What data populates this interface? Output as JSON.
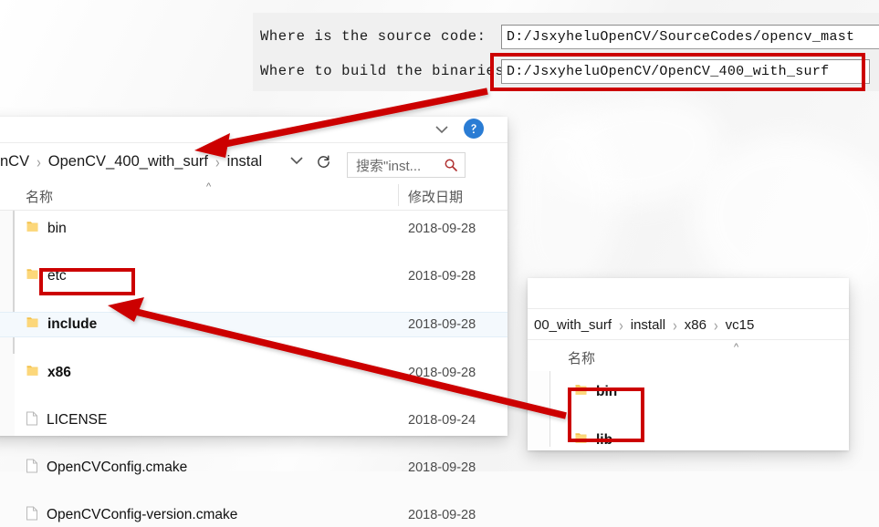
{
  "background": {
    "color": "#fbfbfb"
  },
  "accents": {
    "highlight_red": "#cc0000",
    "folder_yellow": "#f6c555",
    "help_blue": "#2a7cd4",
    "selection_blue": "#f4f9fd"
  },
  "cmake_dialog": {
    "source_row": {
      "label": "Where is the source code:",
      "value": "D:/JsxyheluOpenCV/SourceCodes/opencv_mast",
      "highlighted": false
    },
    "build_row": {
      "label": "Where to build the binaries:",
      "value": "D:/JsxyheluOpenCV/OpenCV_400_with_surf",
      "highlighted": true
    }
  },
  "explorer_main": {
    "breadcrumb": [
      {
        "label": "nCV"
      },
      {
        "label": "OpenCV_400_with_surf"
      },
      {
        "label": "install"
      }
    ],
    "breadcrumb_separator": "›",
    "dropdown_icon": "chevron-down-icon",
    "refresh_icon": "refresh-icon",
    "search": {
      "placeholder": "搜索\"inst...",
      "icon": "search-icon"
    },
    "help_icon": "help-icon",
    "columns": [
      {
        "key": "name",
        "label": "名称"
      },
      {
        "key": "date",
        "label": "修改日期"
      }
    ],
    "sort_indicator": "^",
    "rows": [
      {
        "name": "bin",
        "date": "2018-09-28",
        "type": "folder",
        "selected": false,
        "highlighted": false
      },
      {
        "name": "etc",
        "date": "2018-09-28",
        "type": "folder",
        "selected": false,
        "highlighted": false
      },
      {
        "name": "include",
        "date": "2018-09-28",
        "type": "folder",
        "selected": true,
        "highlighted": true
      },
      {
        "name": "x86",
        "date": "2018-09-28",
        "type": "folder",
        "selected": false,
        "highlighted": false
      },
      {
        "name": "LICENSE",
        "date": "2018-09-24",
        "type": "file",
        "selected": false,
        "highlighted": false
      },
      {
        "name": "OpenCVConfig.cmake",
        "date": "2018-09-28",
        "type": "file",
        "selected": false,
        "highlighted": false
      },
      {
        "name": "OpenCVConfig-version.cmake",
        "date": "2018-09-28",
        "type": "file",
        "selected": false,
        "highlighted": false
      }
    ]
  },
  "explorer_secondary": {
    "breadcrumb": [
      {
        "label": "00_with_surf"
      },
      {
        "label": "install"
      },
      {
        "label": "x86"
      },
      {
        "label": "vc15"
      }
    ],
    "breadcrumb_separator": "›",
    "columns": [
      {
        "key": "name",
        "label": "名称"
      }
    ],
    "sort_indicator": "^",
    "up_caret": "^",
    "rows": [
      {
        "name": "bin",
        "type": "folder",
        "highlighted": true
      },
      {
        "name": "lib",
        "type": "folder",
        "highlighted": true
      }
    ]
  },
  "annotations": {
    "arrow_1": {
      "from": "cmake-build-path-box",
      "to": "explorer-breadcrumb-OpenCV_400_with_surf"
    },
    "arrow_2": {
      "from": "vc15-bin-lib-box",
      "to": "file-row-x86"
    },
    "boxes": [
      {
        "name": "cmake-build-path-box"
      },
      {
        "name": "include-row-box"
      },
      {
        "name": "bin-lib-box"
      }
    ]
  }
}
